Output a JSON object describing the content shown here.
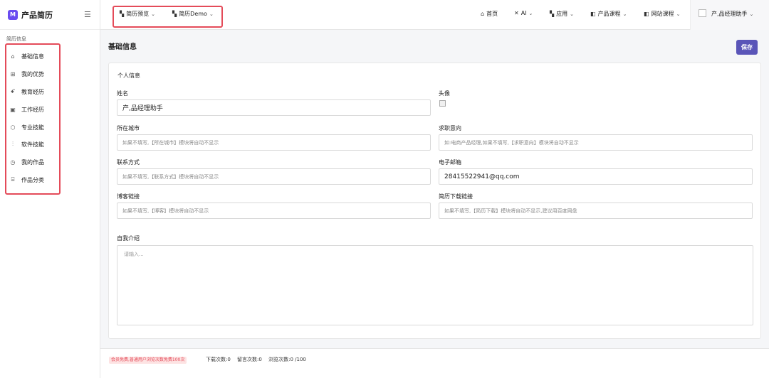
{
  "brand": {
    "logo": "M",
    "name": "产品简历"
  },
  "sidebar": {
    "section": "简历信息",
    "items": [
      {
        "label": "基础信息",
        "icon": "home-icon"
      },
      {
        "label": "我的优势",
        "icon": "grid-icon"
      },
      {
        "label": "教育经历",
        "icon": "users-icon"
      },
      {
        "label": "工作经历",
        "icon": "gift-icon"
      },
      {
        "label": "专业技能",
        "icon": "cube-icon"
      },
      {
        "label": "软件技能",
        "icon": "sliders-icon"
      },
      {
        "label": "我的作品",
        "icon": "clock-icon"
      },
      {
        "label": "作品分类",
        "icon": "building-icon"
      }
    ]
  },
  "topbar": {
    "left": [
      {
        "label": "简历预览",
        "icon": "grid-icon"
      },
      {
        "label": "简历Demo",
        "icon": "grid-icon"
      }
    ],
    "right": [
      {
        "label": "首页",
        "icon": "home-icon"
      },
      {
        "label": "AI",
        "icon": "tools-icon"
      },
      {
        "label": "应用",
        "icon": "grid-icon"
      },
      {
        "label": "产品课程",
        "icon": "book-icon"
      },
      {
        "label": "网站课程",
        "icon": "book-icon"
      }
    ],
    "user": "产,品经理助手"
  },
  "main": {
    "title": "基础信息",
    "save": "保存",
    "card_title": "个人信息",
    "fields": {
      "name": {
        "label": "姓名",
        "value": "产,品经理助手"
      },
      "avatar": {
        "label": "头像"
      },
      "city": {
        "label": "所在城市",
        "placeholder": "如果不填写,【所在城市】模块将自动不显示"
      },
      "intent": {
        "label": "求职意向",
        "placeholder": "如:电商产品经理,如果不填写,【求职意向】模块将自动不显示"
      },
      "contact": {
        "label": "联系方式",
        "placeholder": "如果不填写,【联系方式】模块将自动不显示"
      },
      "email": {
        "label": "电子邮箱",
        "value": "28415522941@qq.com"
      },
      "blog": {
        "label": "博客链接",
        "placeholder": "如果不填写,【博客】模块将自动不显示"
      },
      "download": {
        "label": "简历下载链接",
        "placeholder": "如果不填写,【简历下载】模块将自动不显示,建议用百度网盘"
      },
      "intro": {
        "label": "自我介绍",
        "placeholder": "请输入..."
      }
    }
  },
  "footer": {
    "tag": "会员免费,普通用户浏览次数免费100次",
    "downloads": "下载次数:0",
    "messages": "留言次数:0",
    "views": "浏览次数:0 /100"
  },
  "colors": {
    "accent": "#5a55b8",
    "highlight": "#e44b59",
    "brand": "#6a4cf0"
  }
}
